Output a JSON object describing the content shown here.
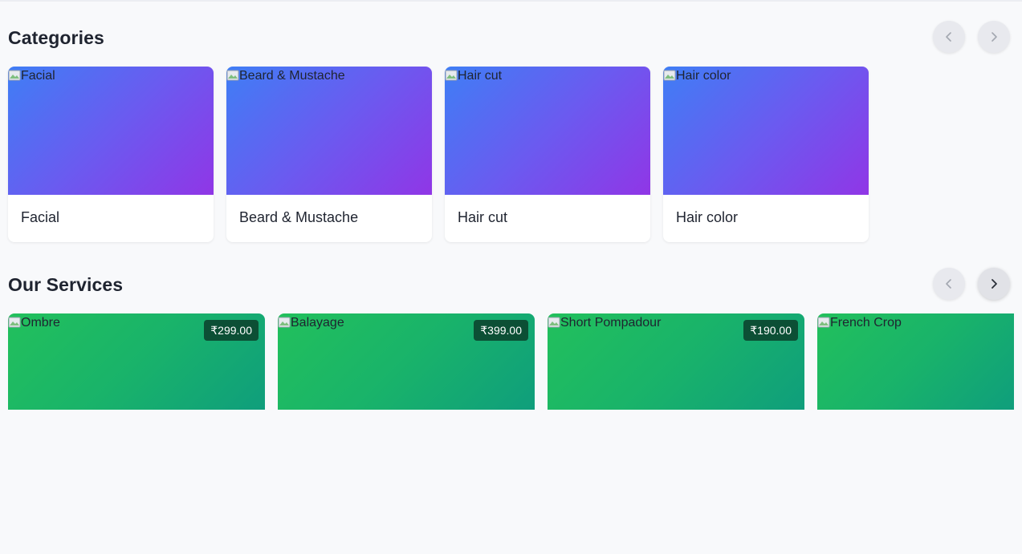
{
  "categories": {
    "title": "Categories",
    "items": [
      {
        "alt": "Facial",
        "label": "Facial"
      },
      {
        "alt": "Beard & Mustache",
        "label": "Beard & Mustache"
      },
      {
        "alt": "Hair cut",
        "label": "Hair cut"
      },
      {
        "alt": "Hair color",
        "label": "Hair color"
      }
    ]
  },
  "services": {
    "title": "Our Services",
    "items": [
      {
        "alt": "Ombre",
        "price": "₹299.00"
      },
      {
        "alt": "Balayage",
        "price": "₹399.00"
      },
      {
        "alt": "Short Pompadour",
        "price": "₹190.00"
      },
      {
        "alt": "French Crop",
        "price": ""
      }
    ]
  },
  "colors": {
    "page_bg": "#f8f9fb",
    "category_gradient": [
      "#3f7ef5",
      "#9036e6"
    ],
    "service_gradient": [
      "#22c05c",
      "#0f9e7c"
    ],
    "price_badge_bg": "#0c4f35"
  },
  "icons": {
    "prev": "chevron-left-icon",
    "next": "chevron-right-icon",
    "broken_image": "broken-image-icon"
  }
}
